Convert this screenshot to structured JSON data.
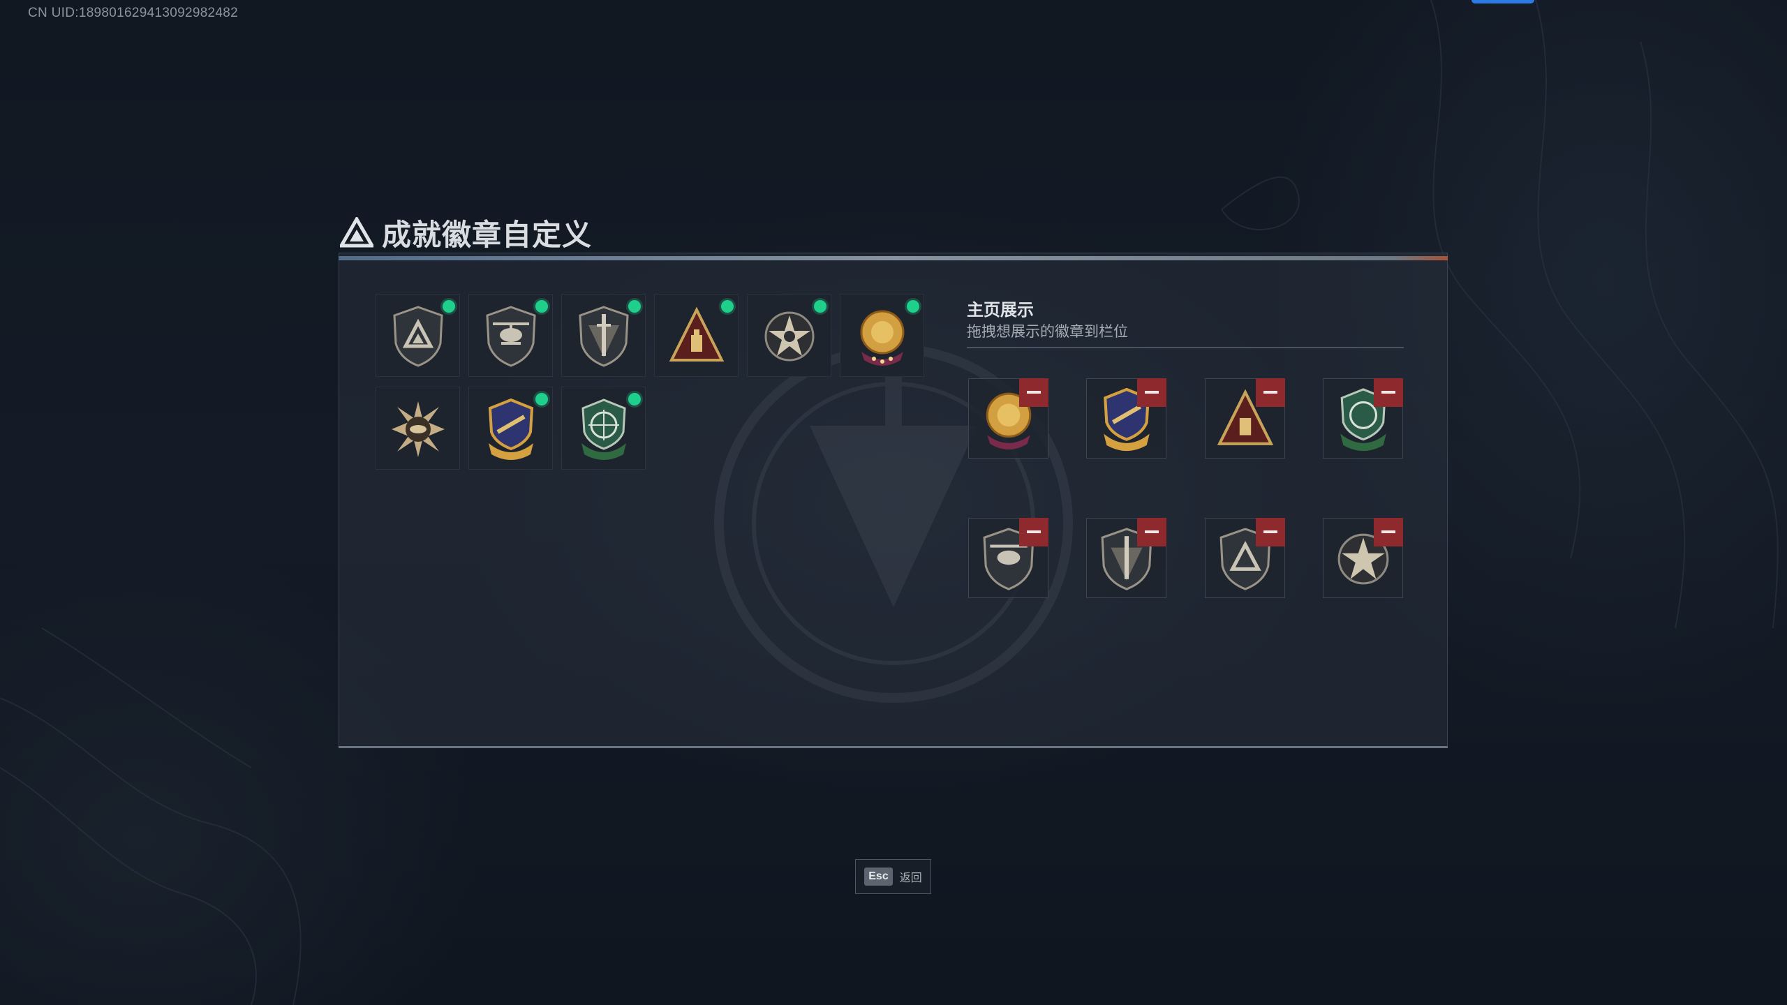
{
  "uid": "CN UID:1898016294130929824​82",
  "title": "成就徽章自定义",
  "collection": {
    "badges": [
      {
        "icon": "delta-shield-badge-icon",
        "equipped": true
      },
      {
        "icon": "helicopter-badge-icon",
        "equipped": true
      },
      {
        "icon": "dagger-shield-badge-icon",
        "equipped": true
      },
      {
        "icon": "pyramid-badge-icon",
        "equipped": true
      },
      {
        "icon": "skull-star-badge-icon",
        "equipped": true
      },
      {
        "icon": "lion-crest-badge-icon",
        "equipped": true
      },
      {
        "icon": "sunburst-eye-badge-icon",
        "equipped": false
      },
      {
        "icon": "rifle-crest-badge-icon",
        "equipped": true
      },
      {
        "icon": "green-scope-badge-icon",
        "equipped": true
      }
    ]
  },
  "showcase": {
    "title": "主页展示",
    "subtitle": "拖拽想展示的徽章到栏位",
    "slots": [
      {
        "icon": "lion-crest-badge-icon"
      },
      {
        "icon": "rifle-crest-badge-icon"
      },
      {
        "icon": "pyramid-badge-icon"
      },
      {
        "icon": "green-scope-badge-icon"
      },
      {
        "icon": "helicopter-badge-icon"
      },
      {
        "icon": "dagger-shield-badge-icon"
      },
      {
        "icon": "delta-shield-badge-icon"
      },
      {
        "icon": "skull-star-badge-icon"
      }
    ]
  },
  "footer": {
    "esc_key": "Esc",
    "back_label": "返回"
  },
  "colors": {
    "equipped_dot": "#1fd08c",
    "remove_button": "#8e2a2d",
    "accent_blue": "#2c7be5"
  }
}
